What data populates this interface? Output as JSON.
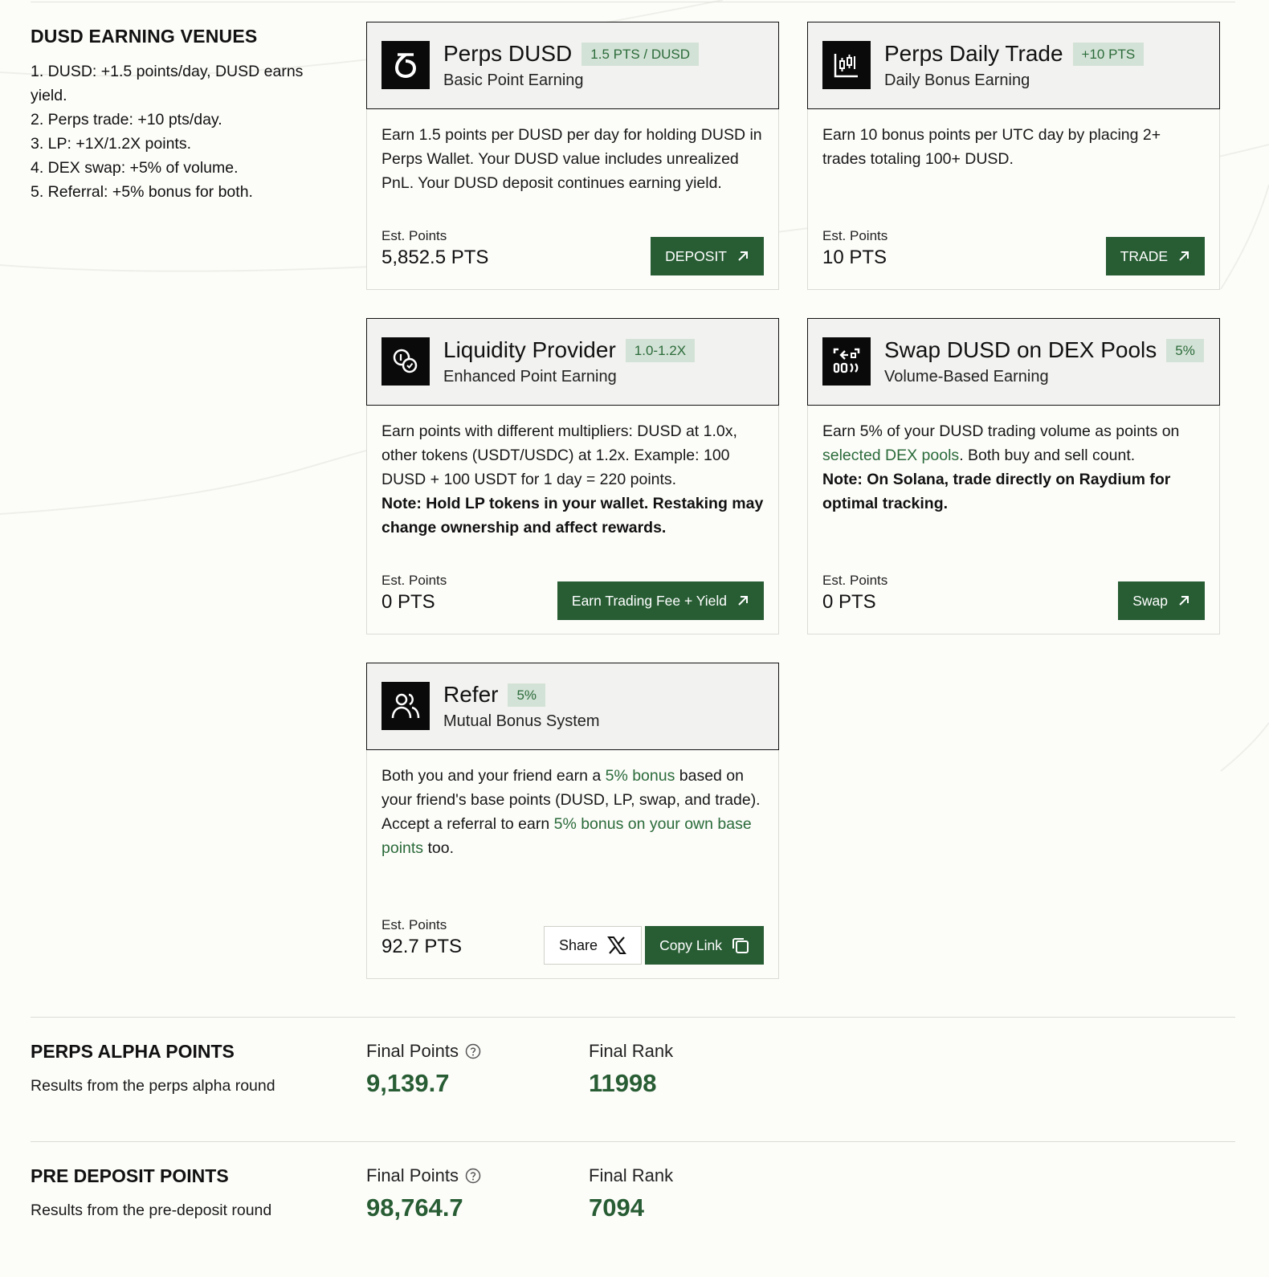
{
  "venues": {
    "title": "DUSD EARNING VENUES",
    "items": [
      "1. DUSD: +1.5 points/day, DUSD earns yield.",
      "2. Perps trade: +10 pts/day.",
      "3. LP: +1X/1.2X points.",
      "4. DEX swap: +5% of volume.",
      "5. Referral: +5% bonus for both."
    ]
  },
  "cards": {
    "perps_dusd": {
      "icon": "dusd-logo-icon",
      "title": "Perps DUSD",
      "badge": "1.5 PTS / DUSD",
      "subtitle": "Basic Point Earning",
      "body": "Earn 1.5 points per DUSD per day for holding DUSD in Perps Wallet. Your DUSD value includes unrealized PnL. Your DUSD deposit continues earning yield.",
      "est_label": "Est. Points",
      "est_value": "5,852.5 PTS",
      "button": "DEPOSIT"
    },
    "perps_daily": {
      "icon": "candlestick-chart-icon",
      "title": "Perps Daily Trade",
      "badge": "+10 PTS",
      "subtitle": "Daily Bonus Earning",
      "body": "Earn 10 bonus points per UTC day by placing 2+ trades totaling 100+ DUSD.",
      "est_label": "Est. Points",
      "est_value": "10 PTS",
      "button": "TRADE"
    },
    "lp": {
      "icon": "coins-icon",
      "title": "Liquidity Provider",
      "badge": "1.0-1.2X",
      "subtitle": "Enhanced Point Earning",
      "body": "Earn points with different multipliers: DUSD at 1.0x, other tokens (USDT/USDC) at 1.2x. Example: 100 DUSD + 100 USDT for 1 day = 220 points.",
      "note": "Note: Hold LP tokens in your wallet. Restaking may change ownership and affect rewards.",
      "est_label": "Est. Points",
      "est_value": "0 PTS",
      "button": "Earn Trading Fee + Yield"
    },
    "swap": {
      "icon": "swap-scan-icon",
      "title": "Swap DUSD on DEX Pools",
      "badge": "5%",
      "subtitle": "Volume-Based Earning",
      "body_pre": "Earn 5% of your DUSD trading volume as points on ",
      "body_link": "selected DEX pools",
      "body_post": ". Both buy and sell count.",
      "note": "Note: On Solana, trade directly on Raydium for optimal tracking.",
      "est_label": "Est. Points",
      "est_value": "0 PTS",
      "button": "Swap"
    },
    "refer": {
      "icon": "users-icon",
      "title": "Refer",
      "badge": "5%",
      "subtitle": "Mutual Bonus System",
      "p1_pre": "Both you and your friend earn a ",
      "p1_hl": "5% bonus",
      "p1_post": " based on your friend's base points (DUSD, LP, swap, and trade).",
      "p2_pre": "Accept a referral to earn ",
      "p2_hl": "5% bonus on your own base points",
      "p2_post": " too.",
      "est_label": "Est. Points",
      "est_value": "92.7 PTS",
      "share_button": "Share",
      "copy_button": "Copy Link"
    }
  },
  "perps_alpha": {
    "title": "PERPS ALPHA POINTS",
    "desc": "Results from the perps alpha round",
    "points_label": "Final Points",
    "points_value": "9,139.7",
    "rank_label": "Final Rank",
    "rank_value": "11998"
  },
  "pre_deposit": {
    "title": "PRE DEPOSIT POINTS",
    "desc": "Results from the pre-deposit round",
    "points_label": "Final Points",
    "points_value": "98,764.7",
    "rank_label": "Final Rank",
    "rank_value": "7094"
  },
  "colors": {
    "accent": "#285d34",
    "badge_bg": "#d3e2d6",
    "highlight_text": "#2b6b3a",
    "page_bg": "#fcfcf9"
  }
}
